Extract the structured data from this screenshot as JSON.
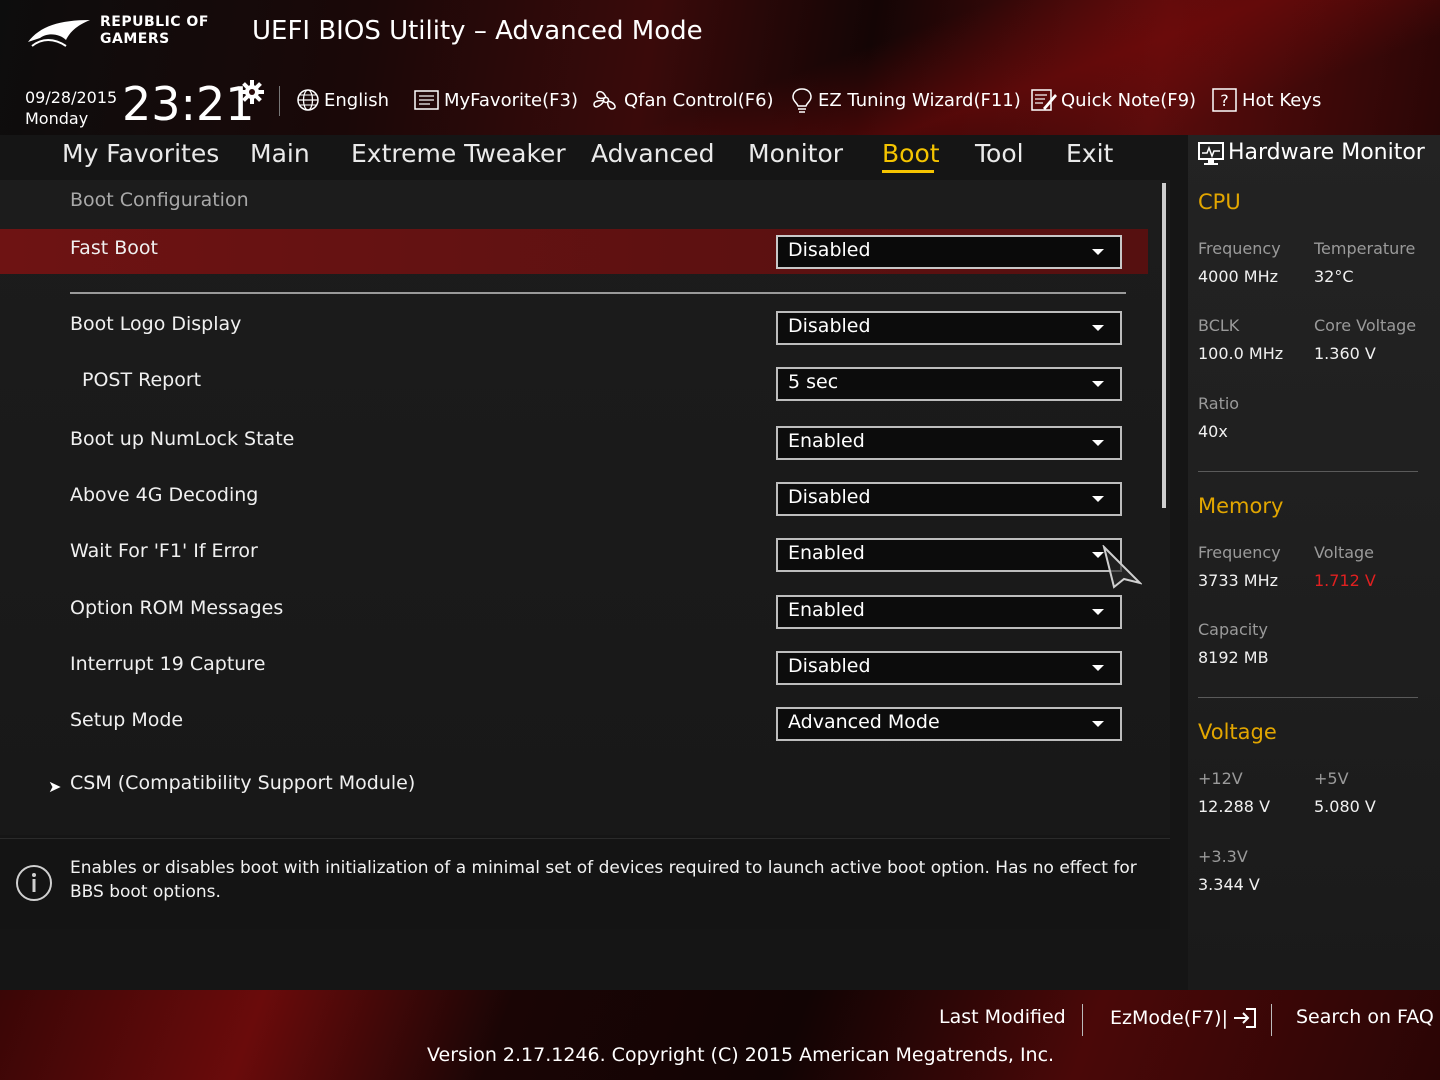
{
  "header": {
    "brand_line1": "REPUBLIC OF",
    "brand_line2": "GAMERS",
    "title": "UEFI BIOS Utility – Advanced Mode",
    "date": "09/28/2015",
    "day": "Monday",
    "time": "23:21"
  },
  "toolbar": {
    "language": "English",
    "myfavorite": "MyFavorite(F3)",
    "qfan": "Qfan Control(F6)",
    "ez_tuning": "EZ Tuning Wizard(F11)",
    "quick_note": "Quick Note(F9)",
    "hot_keys": "Hot Keys"
  },
  "menu": {
    "items": [
      "My Favorites",
      "Main",
      "Extreme Tweaker",
      "Advanced",
      "Monitor",
      "Boot",
      "Tool",
      "Exit"
    ],
    "active": "Boot"
  },
  "boot": {
    "section_title": "Boot Configuration",
    "settings": [
      {
        "label": "Fast Boot",
        "value": "Disabled"
      },
      {
        "label": "Boot Logo Display",
        "value": "Disabled"
      },
      {
        "label": "POST Report",
        "value": "5 sec"
      },
      {
        "label": "Boot up NumLock State",
        "value": "Enabled"
      },
      {
        "label": "Above 4G Decoding",
        "value": "Disabled"
      },
      {
        "label": "Wait For 'F1' If Error",
        "value": "Enabled"
      },
      {
        "label": "Option ROM Messages",
        "value": "Enabled"
      },
      {
        "label": "Interrupt 19 Capture",
        "value": "Disabled"
      },
      {
        "label": "Setup Mode",
        "value": "Advanced Mode"
      }
    ],
    "submenu": "CSM (Compatibility Support Module)"
  },
  "help": {
    "text": "Enables or disables boot with initialization of a minimal set of devices required to launch active boot option. Has no effect for BBS boot options."
  },
  "hardware_monitor": {
    "title": "Hardware Monitor",
    "cpu": {
      "title": "CPU",
      "frequency_label": "Frequency",
      "frequency": "4000 MHz",
      "temperature_label": "Temperature",
      "temperature": "32°C",
      "bclk_label": "BCLK",
      "bclk": "100.0 MHz",
      "core_voltage_label": "Core Voltage",
      "core_voltage": "1.360 V",
      "ratio_label": "Ratio",
      "ratio": "40x"
    },
    "memory": {
      "title": "Memory",
      "frequency_label": "Frequency",
      "frequency": "3733 MHz",
      "voltage_label": "Voltage",
      "voltage": "1.712 V",
      "capacity_label": "Capacity",
      "capacity": "8192 MB"
    },
    "voltage": {
      "title": "Voltage",
      "v12_label": "+12V",
      "v12": "12.288 V",
      "v5_label": "+5V",
      "v5": "5.080 V",
      "v33_label": "+3.3V",
      "v33": "3.344 V"
    },
    "warn_color": "#e02020",
    "accent_color": "#e2a600"
  },
  "footer": {
    "last_modified": "Last Modified",
    "ezmode": "EzMode(F7)|",
    "search_faq": "Search on FAQ",
    "version": "Version 2.17.1246. Copyright (C) 2015 American Megatrends, Inc."
  },
  "icons": [
    "rog-logo",
    "gear-icon",
    "globe-icon",
    "favorite-icon",
    "fan-icon",
    "bulb-icon",
    "note-icon",
    "help-icon",
    "monitor-icon",
    "info-icon",
    "exit-arrow-icon",
    "chevron-right-icon"
  ],
  "colors": {
    "active_menu": "#f5c400",
    "selected_row": "#6e1313"
  }
}
